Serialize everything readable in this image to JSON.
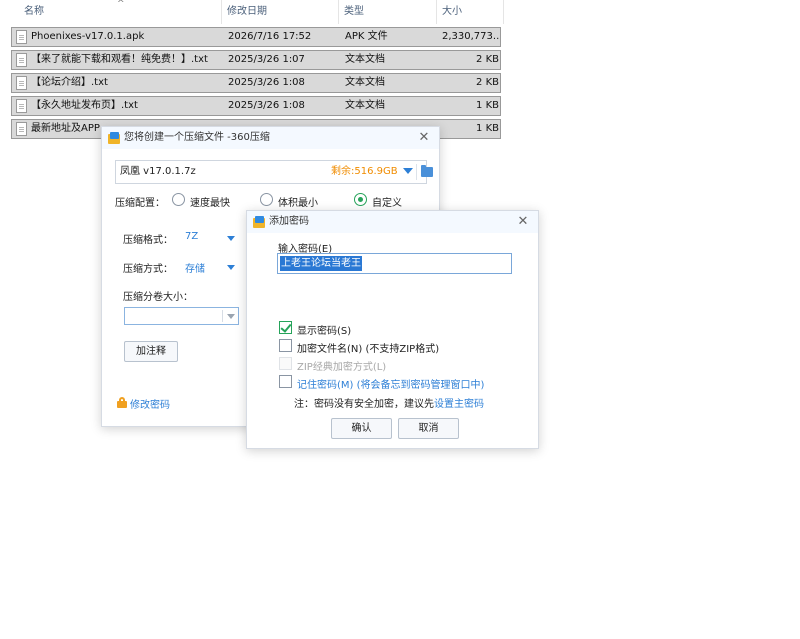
{
  "explorer": {
    "columns": {
      "name": "名称",
      "date": "修改日期",
      "type": "类型",
      "size": "大小"
    },
    "sort_indicator": "^",
    "files": [
      {
        "name": "Phoenixes-v17.0.1.apk",
        "date": "2026/7/16 17:52",
        "type": "APK 文件",
        "size": "2,330,773..."
      },
      {
        "name": "【来了就能下载和观看！纯免费！】.txt",
        "date": "2025/3/26 1:07",
        "type": "文本文档",
        "size": "2 KB"
      },
      {
        "name": "【论坛介绍】.txt",
        "date": "2025/3/26 1:08",
        "type": "文本文档",
        "size": "2 KB"
      },
      {
        "name": "【永久地址发布页】.txt",
        "date": "2025/3/26 1:08",
        "type": "文本文档",
        "size": "1 KB"
      },
      {
        "name": "最新地址及APP",
        "date": "",
        "type": "",
        "size": "1 KB"
      }
    ]
  },
  "compress_dialog": {
    "title": "您将创建一个压缩文件 -360压缩",
    "close_glyph": "✕",
    "archive_name": "凤凰  v17.0.1.7z",
    "free_space": "剩余:516.9GB",
    "config_label": "压缩配置：",
    "options": [
      "速度最快",
      "体积最小",
      "自定义"
    ],
    "selected_option": "自定义",
    "format_label": "压缩格式：",
    "format_value": "7Z",
    "method_label": "压缩方式：",
    "method_value": "存储",
    "volume_label": "压缩分卷大小：",
    "volume_value": "",
    "comment_button": "加注释",
    "change_password_link": "修改密码"
  },
  "password_dialog": {
    "title": "添加密码",
    "close_glyph": "✕",
    "input_label": "输入密码(E)",
    "password_value": "上老王论坛当老王",
    "options": [
      {
        "label": "显示密码(S)",
        "checked": true,
        "disabled": false
      },
      {
        "label": "加密文件名(N) (不支持ZIP格式)",
        "checked": false,
        "disabled": false
      },
      {
        "label": "ZIP经典加密方式(L)",
        "checked": false,
        "disabled": true
      },
      {
        "label": "记住密码(M) (将会备忘到密码管理窗口中)",
        "checked": false,
        "disabled": false
      }
    ],
    "note_prefix": "注：密码没有安全加密，建议先",
    "note_link": "设置主密码",
    "ok_button": "确认",
    "cancel_button": "取消"
  },
  "colors": {
    "accent": "#2d7fd6",
    "warning": "#f08c00",
    "check_green": "#26a35a",
    "selection_gray": "#d9d9d9"
  }
}
